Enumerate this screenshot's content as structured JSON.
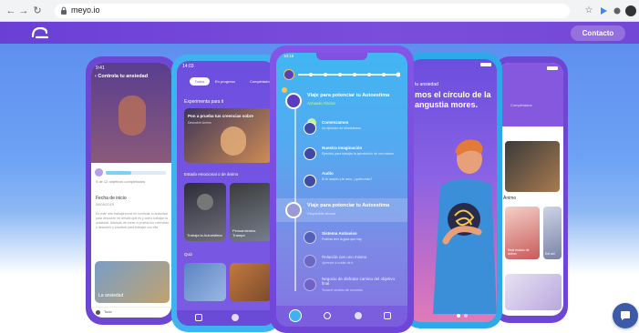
{
  "browser": {
    "url": "meyo.io"
  },
  "header": {
    "contact_label": "Contacto"
  },
  "phone1": {
    "status_time": "9:41",
    "title": "Controla tu ansiedad",
    "progress_text": "5 de 12 objetivos completados",
    "start_label": "Fecha de inicio",
    "start_date": "08/05/2019",
    "body": "En este reto trabajaremos en controlar tu ansiedad para descubrir en detalle qué es y cómo trabajar la ansiedad. Además de poner a prueba tus creencias y descubrir y practicar para trabajar con ella.",
    "card_label": "La ansiedad",
    "bottom_label": "Todo"
  },
  "phone2": {
    "status_time": "14:03",
    "tabs": [
      "Todos",
      "En progreso",
      "Completados"
    ],
    "section1": "Experimenta para ti",
    "card1_title": "Pon a prueba tus creencias sobre",
    "card1_sub": "Descubrir Animo",
    "section2": "Estado emocional o de ánimo",
    "tile1": "Trabaja la Autoestima",
    "tile2": "Pensamientos Trampa",
    "section3": "Quiz"
  },
  "phone3": {
    "status_time": "10:15",
    "journey1_title": "Viaje para potenciar tu Autoestima",
    "journey1_status": "Actuado Ahora!",
    "step1_title": "Comenzamos",
    "step1_sub": "Un ejercicio de Mindfulness",
    "step2_title": "Nuestra Imaginación",
    "step2_sub": "Ejercicio para trabajar la aprobación de uno mismo",
    "step3_title": "Audio",
    "step3_sub": "Si te acepto y te amo, ¿quién más?",
    "journey2_title": "Viaje para potenciar tu Autoestima",
    "journey2_status": "Disponible Ahora!",
    "step4_title": "Sistema Antiaviso",
    "step4_sub": "Podrías leer la guía que hay",
    "step5_title": "Relación con uno mismo",
    "step5_sub": "Aprende a cuidar de ti",
    "step6_title": "Negocio de disfrutar camino del objetivo final",
    "step6_sub": "Toma el sentido del recorrido"
  },
  "phone4": {
    "headline_small": "tu ansiedad",
    "headline": "mos el círculo de la angustia mores."
  },
  "phone5": {
    "tab": "Completados",
    "section": "Ánimo",
    "tile1": "Real estado de ánimo",
    "tile2": "Est ani"
  }
}
